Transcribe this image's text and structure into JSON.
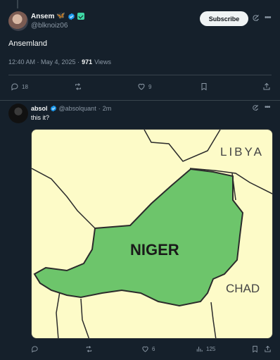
{
  "main_tweet": {
    "author_name": "Ansem",
    "author_handle": "@blknoiz06",
    "subscribe_label": "Subscribe",
    "text": "Ansemland",
    "timestamp": "12:40 AM · May 4, 2025 · ",
    "views_count": "971",
    "views_label": " Views",
    "replies": "18",
    "retweets": "",
    "likes": "9",
    "icons": [
      "butterfly-icon",
      "verified-icon",
      "square-badge-icon",
      "grok-icon",
      "more-icon",
      "reply-icon",
      "retweet-icon",
      "like-icon",
      "bookmark-icon",
      "share-icon"
    ]
  },
  "reply_tweet": {
    "author_name": "absol",
    "author_handle": "@absolquant",
    "time": "2m",
    "text": "this it?",
    "image": {
      "labels": [
        "LIBYA",
        "NIGER",
        "CHAD"
      ],
      "colors": {
        "land": "#fdfbc8",
        "highlight": "#6dc56b",
        "border": "#2b2b2b"
      }
    },
    "replies": "",
    "retweets": "",
    "likes": "6",
    "views": "125"
  },
  "colors": {
    "background": "#15202b",
    "text": "#f7f9f9",
    "secondary": "#8b98a5",
    "accent": "#1d9bf0",
    "divider": "#38444d"
  }
}
